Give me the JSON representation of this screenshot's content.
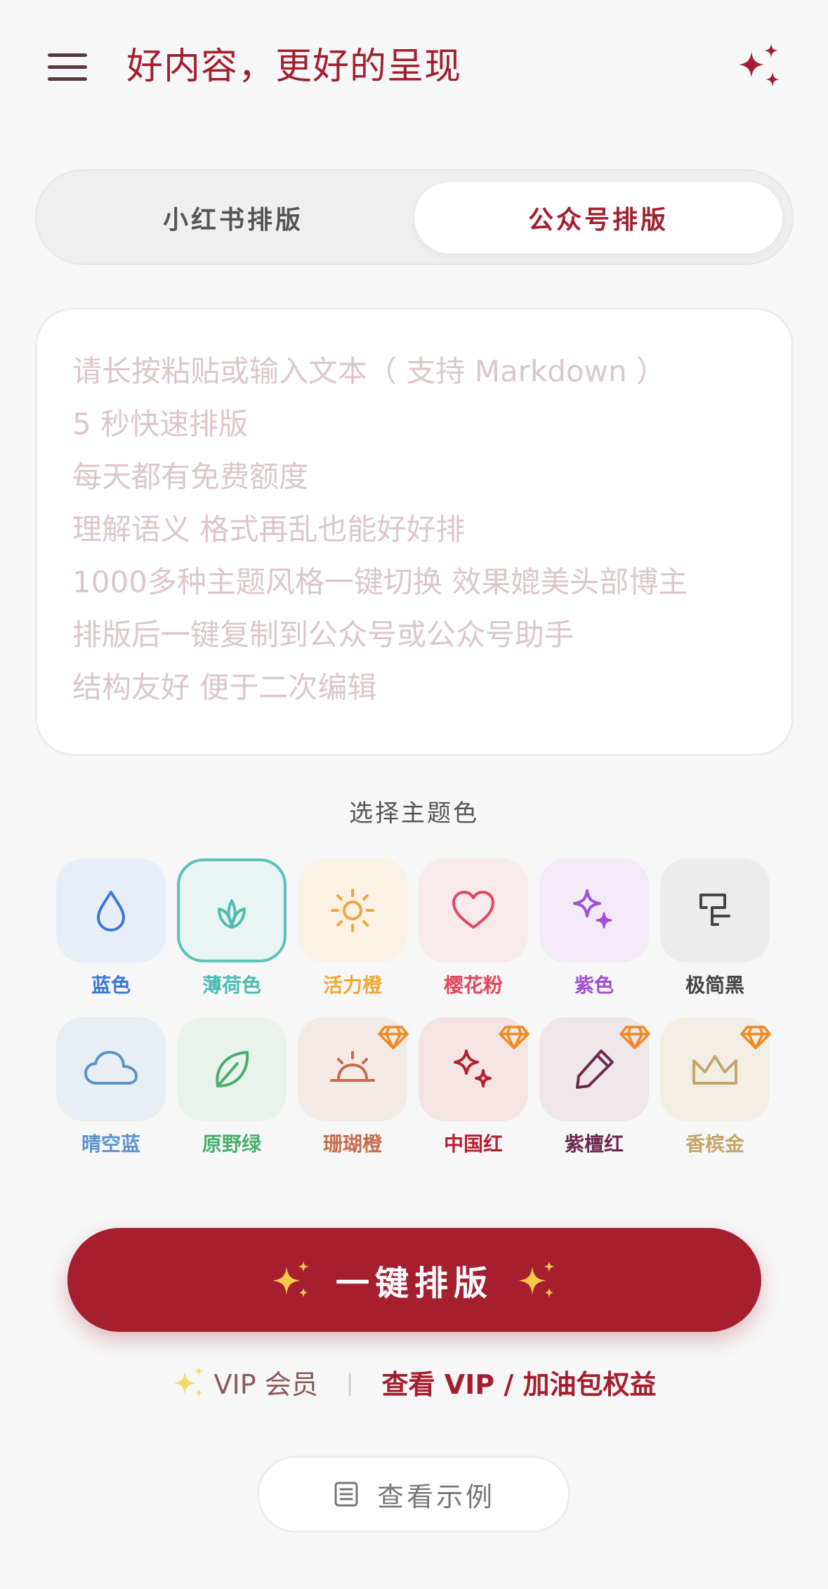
{
  "header": {
    "title": "好内容，更好的呈现",
    "menu_icon": "hamburger-menu-icon",
    "action_icon": "sparkles-icon"
  },
  "tabs": [
    {
      "label": "小红书排版",
      "active": false
    },
    {
      "label": "公众号排版",
      "active": true
    }
  ],
  "editor": {
    "placeholder_lines": [
      "请长按粘贴或输入文本（ 支持 Markdown ）",
      "5 秒快速排版",
      "每天都有免费额度",
      "理解语义 格式再乱也能好好排",
      "1000多种主题风格一键切换 效果媲美头部博主",
      "排版后一键复制到公众号或公众号助手",
      "结构友好 便于二次编辑"
    ]
  },
  "themes": {
    "title": "选择主题色",
    "items": [
      {
        "label": "蓝色",
        "icon": "water-drop-icon",
        "color": "#3a78d8",
        "bg": "#e8eef9",
        "premium": false,
        "selected": false
      },
      {
        "label": "薄荷色",
        "icon": "sprout-icon",
        "color": "#4fbcb1",
        "bg": "#e8f5f3",
        "premium": false,
        "selected": true
      },
      {
        "label": "活力橙",
        "icon": "sun-icon",
        "color": "#f0a63a",
        "bg": "#fbf1e4",
        "premium": false,
        "selected": false
      },
      {
        "label": "樱花粉",
        "icon": "heart-icon",
        "color": "#e2465f",
        "bg": "#f8e9eb",
        "premium": false,
        "selected": false
      },
      {
        "label": "紫色",
        "icon": "sparkle-stars-icon",
        "color": "#a24fd6",
        "bg": "#f2eaf7",
        "premium": false,
        "selected": false
      },
      {
        "label": "极简黑",
        "icon": "minimal-glyph-icon",
        "color": "#444444",
        "bg": "#ececec",
        "premium": false,
        "selected": false
      },
      {
        "label": "晴空蓝",
        "icon": "cloud-icon",
        "color": "#5b93cf",
        "bg": "#e9eef5",
        "premium": false,
        "selected": false
      },
      {
        "label": "原野绿",
        "icon": "leaf-icon",
        "color": "#4aad6d",
        "bg": "#e9f3ec",
        "premium": false,
        "selected": false
      },
      {
        "label": "珊瑚橙",
        "icon": "sunrise-icon",
        "color": "#c66c4b",
        "bg": "#f4ebe6",
        "premium": true,
        "selected": false
      },
      {
        "label": "中国红",
        "icon": "sparkle-stars-icon",
        "color": "#b51f31",
        "bg": "#f4e4e4",
        "premium": true,
        "selected": false
      },
      {
        "label": "紫檀红",
        "icon": "pen-icon",
        "color": "#6d2a4f",
        "bg": "#efe6ea",
        "premium": true,
        "selected": false
      },
      {
        "label": "香槟金",
        "icon": "crown-icon",
        "color": "#c4a56a",
        "bg": "#f2eee4",
        "premium": true,
        "selected": false
      }
    ],
    "premium_badge_icon": "diamond-icon",
    "premium_badge_color": "#f08a22"
  },
  "primary_action": {
    "label": "一键排版",
    "icon": "sparkles-emoji-icon"
  },
  "vip": {
    "label": "VIP 会员",
    "divider": "|",
    "link": "查看 VIP / 加油包权益"
  },
  "example": {
    "label": "查看示例",
    "icon": "document-list-icon"
  },
  "colors": {
    "brand": "#a41f2e",
    "background": "#f7f7f8",
    "placeholder": "#dcc6c9"
  }
}
